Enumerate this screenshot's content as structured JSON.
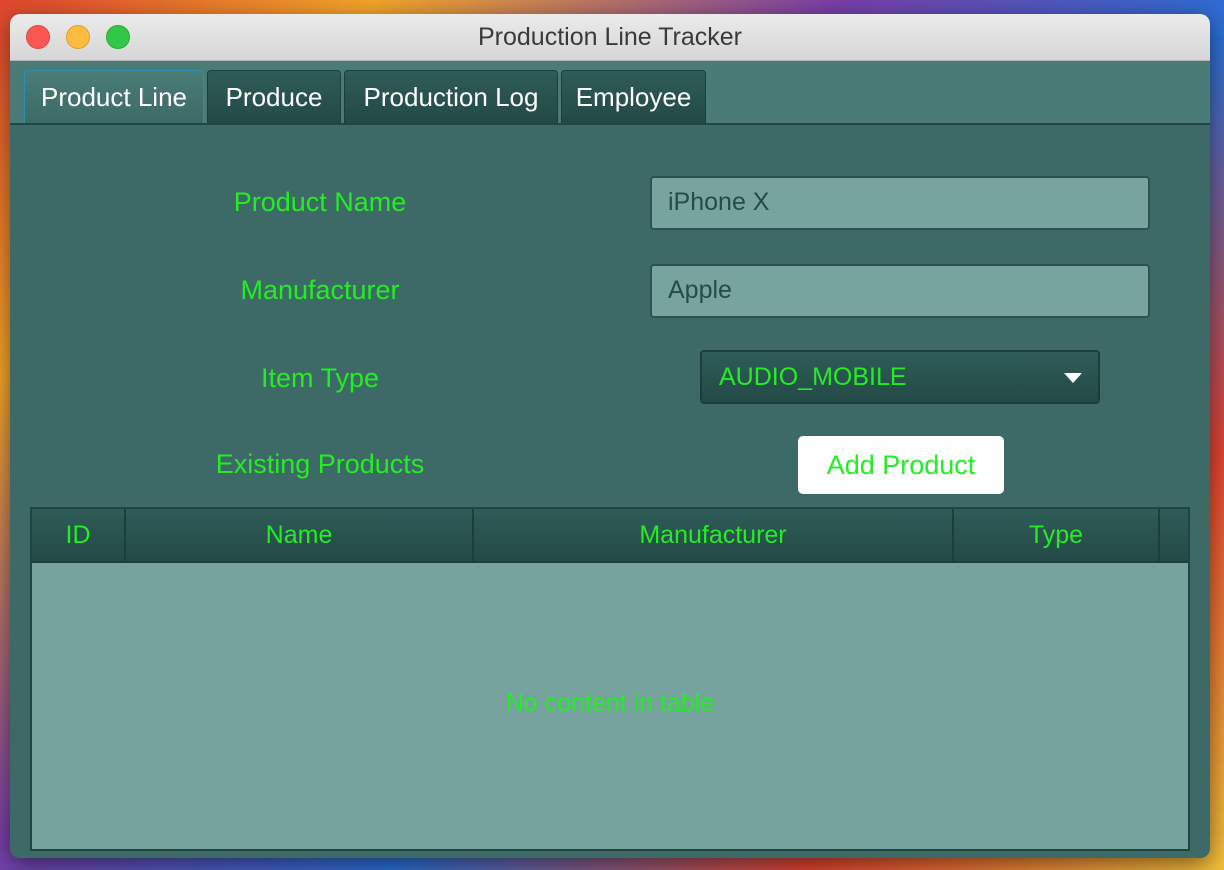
{
  "window": {
    "title": "Production Line Tracker"
  },
  "tabs": [
    {
      "label": "Product Line",
      "active": true
    },
    {
      "label": "Produce",
      "active": false
    },
    {
      "label": "Production Log",
      "active": false
    },
    {
      "label": "Employee",
      "active": false
    }
  ],
  "form": {
    "product_name_label": "Product Name",
    "product_name_value": "iPhone X",
    "manufacturer_label": "Manufacturer",
    "manufacturer_value": "Apple",
    "item_type_label": "Item Type",
    "item_type_value": "AUDIO_MOBILE",
    "existing_products_label": "Existing Products",
    "add_button_label": "Add Product"
  },
  "table": {
    "columns": [
      "ID",
      "Name",
      "Manufacturer",
      "Type"
    ],
    "rows": [],
    "empty_text": "No content in table"
  },
  "colors": {
    "accent_text": "#22ee22",
    "panel_bg": "#3d6a66",
    "field_bg": "#77a49f"
  },
  "icons": {
    "dropdown": "chevron-down-icon",
    "close": "close-icon",
    "minimize": "minimize-icon",
    "zoom": "zoom-icon"
  }
}
